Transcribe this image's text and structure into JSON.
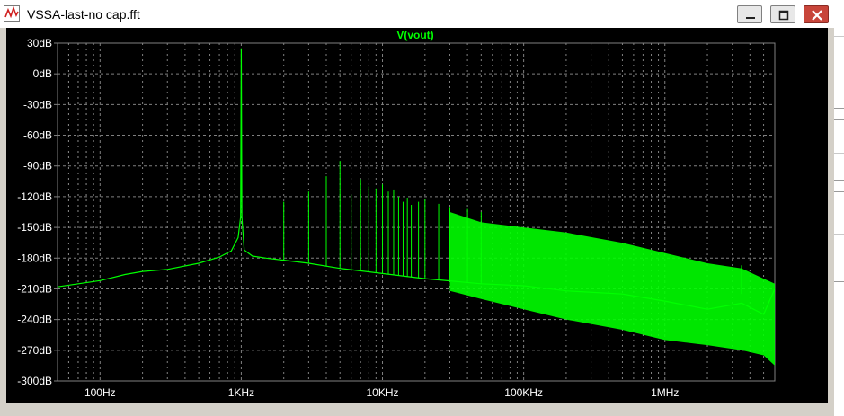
{
  "window": {
    "title": "VSSA-last-no cap.fft"
  },
  "icons": {
    "app": "waveform-icon",
    "minimize": "minimize-icon",
    "maximize": "maximize-icon",
    "close": "close-icon"
  },
  "colors": {
    "trace": "#00ff00",
    "background": "#000000",
    "grid": "#808080",
    "text": "#ffffff",
    "close_button": "#c8453a"
  },
  "chart_data": {
    "type": "line",
    "title": "V(vout)",
    "xlabel": "",
    "ylabel": "",
    "xscale": "log",
    "xlim": [
      50,
      6000000
    ],
    "ylim": [
      -300,
      30
    ],
    "grid": true,
    "legend": "none",
    "yticks": [
      30,
      0,
      -30,
      -60,
      -90,
      -120,
      -150,
      -180,
      -210,
      -240,
      -270,
      -300
    ],
    "ytick_labels": [
      "30dB",
      "0dB",
      "-30dB",
      "-60dB",
      "-90dB",
      "-120dB",
      "-150dB",
      "-180dB",
      "-210dB",
      "-240dB",
      "-270dB",
      "-300dB"
    ],
    "xticks": [
      100,
      1000,
      10000,
      100000,
      1000000
    ],
    "xtick_labels": [
      "100Hz",
      "1KHz",
      "10KHz",
      "100KHz",
      "1MHz"
    ],
    "series": [
      {
        "name": "V(vout)",
        "x": [
          50,
          100,
          150,
          200,
          300,
          500,
          700,
          850,
          950,
          990,
          1000,
          1010,
          1050,
          1200,
          1500,
          2000,
          3000,
          5000,
          10000,
          20000,
          50000,
          100000,
          200000,
          500000,
          1000000,
          2000000,
          3500000,
          5000000,
          6000000
        ],
        "y": [
          -208,
          -202,
          -196,
          -193,
          -191,
          -185,
          -179,
          -173,
          -160,
          -140,
          25,
          -140,
          -172,
          -178,
          -180,
          -182,
          -185,
          -190,
          -195,
          -200,
          -205,
          -207,
          -212,
          -215,
          -222,
          -230,
          -224,
          -235,
          -210
        ],
        "harmonics": {
          "x": [
            2000,
            3000,
            4000,
            5000,
            6000,
            7000,
            8000,
            9000,
            10000,
            11000,
            12000,
            13000,
            14000,
            15000,
            16000,
            18000,
            20000,
            25000,
            30000,
            40000,
            50000
          ],
          "y": [
            -125,
            -115,
            -100,
            -85,
            -118,
            -103,
            -110,
            -112,
            -108,
            -115,
            -113,
            -120,
            -125,
            -121,
            -128,
            -125,
            -122,
            -127,
            -130,
            -132,
            -135
          ]
        },
        "band": {
          "x": [
            30000,
            50000,
            100000,
            200000,
            500000,
            1000000,
            2000000,
            3500000,
            5000000,
            6000000
          ],
          "top": [
            -135,
            -145,
            -150,
            -155,
            -165,
            -175,
            -185,
            -190,
            -200,
            -205
          ],
          "bottom": [
            -212,
            -220,
            -230,
            -240,
            -250,
            -260,
            -265,
            -270,
            -275,
            -285
          ]
        },
        "spur": {
          "x": 3500000,
          "y": -187
        }
      }
    ]
  }
}
